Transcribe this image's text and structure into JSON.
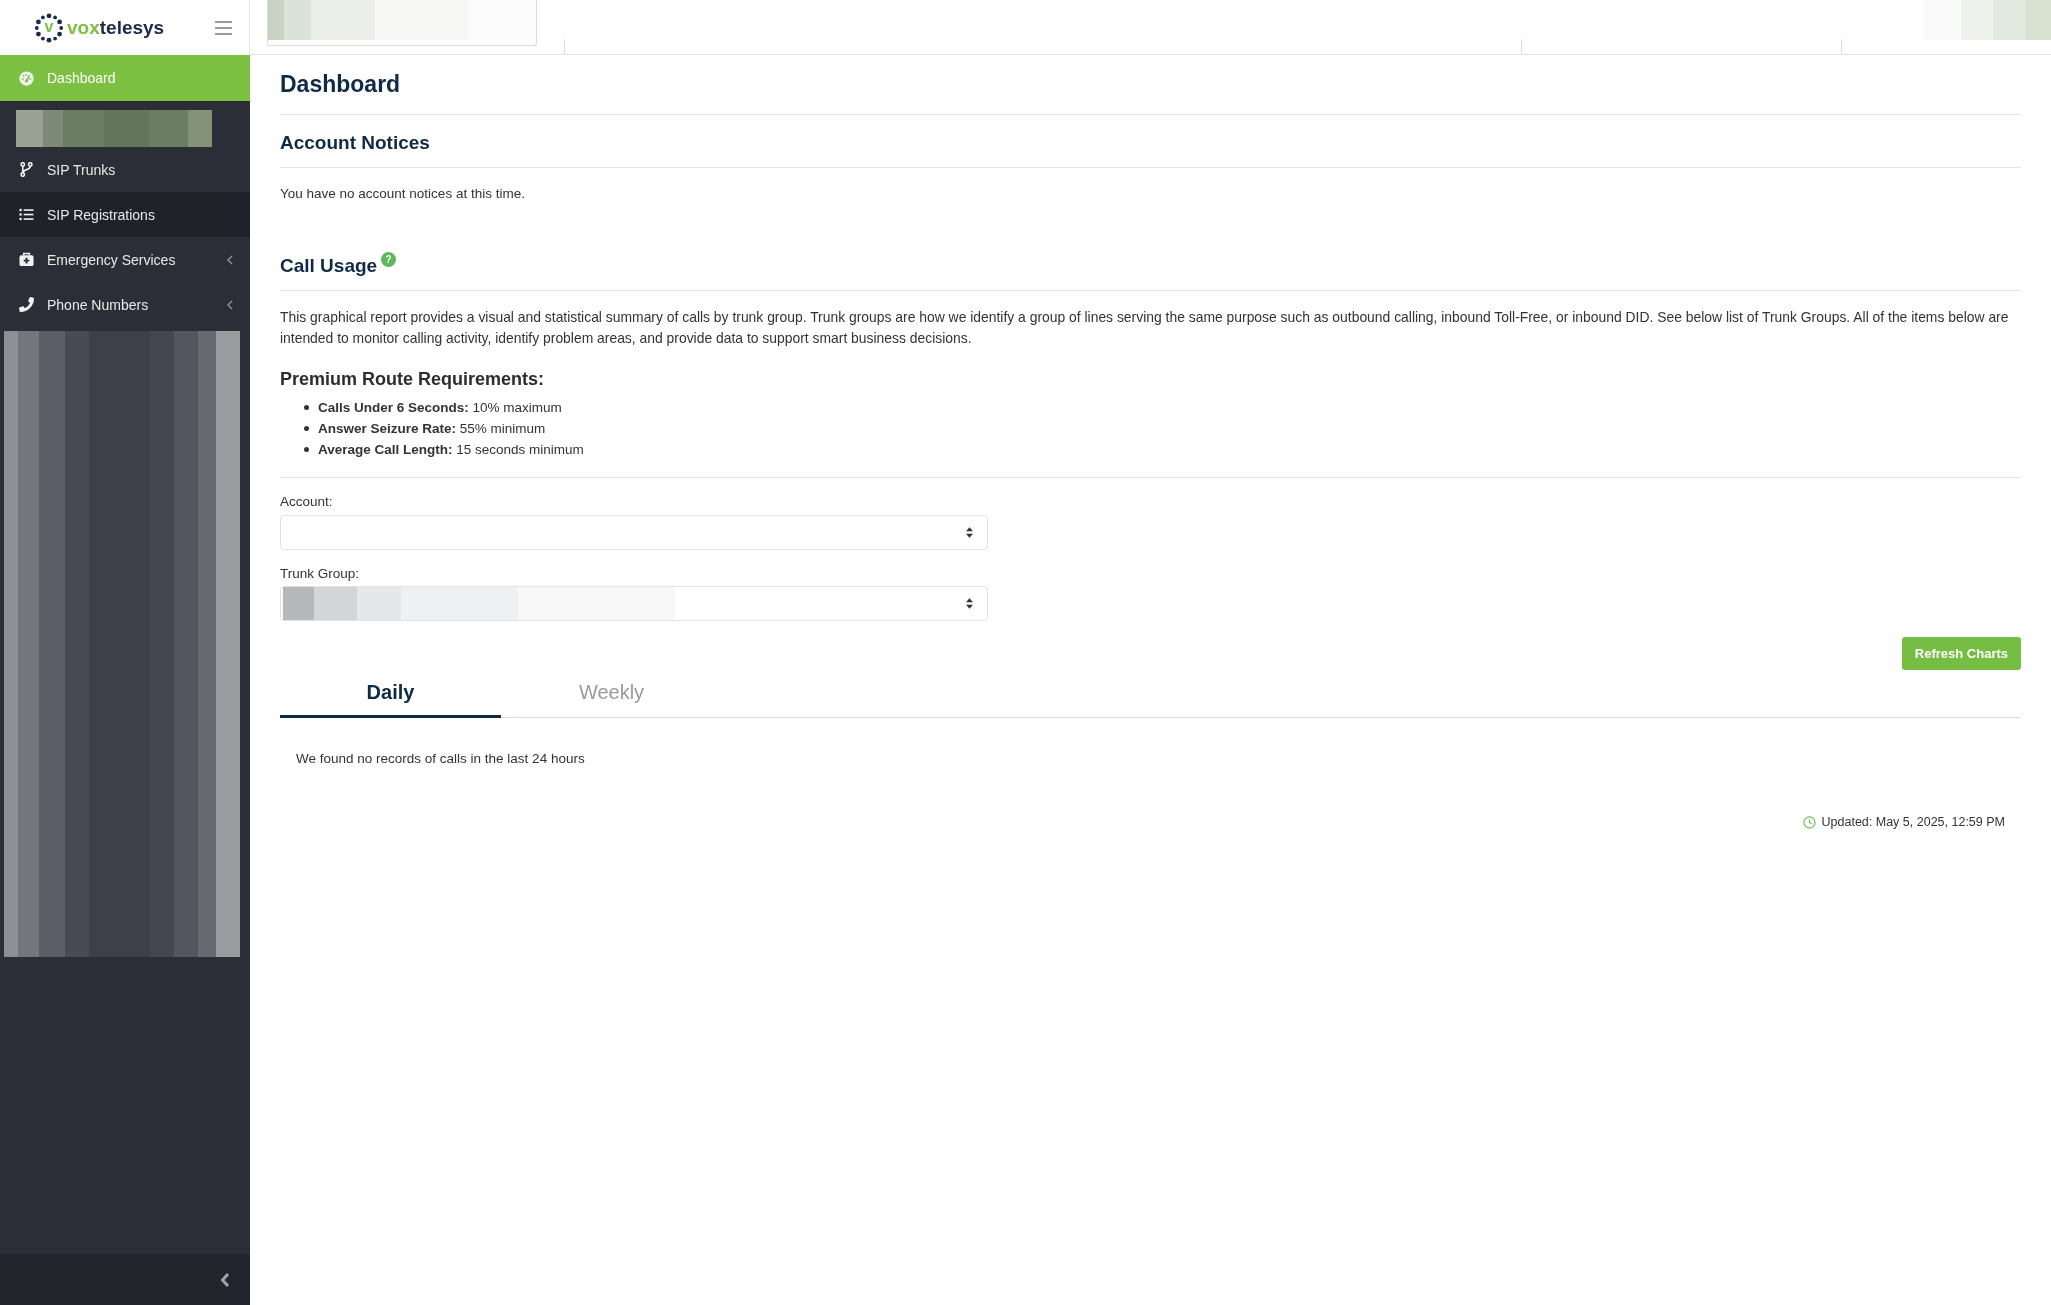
{
  "sidebar": {
    "logo": {
      "mark_letter": "v",
      "parts": [
        {
          "text": "vox",
          "kind": "accent"
        },
        {
          "text": "telesys",
          "kind": "plain"
        }
      ]
    },
    "items": [
      {
        "kind": "link",
        "label": "Dashboard",
        "selected": true,
        "hovered": false
      },
      {
        "kind": "redacted"
      },
      {
        "kind": "link",
        "label": "SIP Trunks",
        "selected": false,
        "hovered": false
      },
      {
        "kind": "link",
        "label": "SIP Registrations",
        "selected": false,
        "hovered": true
      },
      {
        "kind": "submenu",
        "label": "Emergency Services",
        "selected": false,
        "hovered": false,
        "expanded": false
      },
      {
        "kind": "submenu",
        "label": "Phone Numbers",
        "selected": false,
        "hovered": false,
        "expanded": false
      }
    ]
  },
  "page": {
    "title": "Dashboard"
  },
  "account_notices": {
    "title": "Account Notices",
    "message": "You have no account notices at this time."
  },
  "call_usage": {
    "title": "Call Usage",
    "help_icon": "?",
    "description": "This graphical report provides a visual and statistical summary of calls by trunk group. Trunk groups are how we identify a group of lines serving the same purpose such as outbound calling, inbound Toll-Free, or inbound DID. See below list of Trunk Groups. All of the items below are intended to monitor calling activity, identify problem areas, and provide data to support smart business decisions.",
    "requirements_title": "Premium Route Requirements:",
    "requirements": [
      "**Calls Under 6 Seconds:** 10% maximum",
      "**Answer Seizure Rate:** 55% minimum",
      "**Average Call Length:** 15 seconds minimum"
    ],
    "fields": [
      {
        "label": "Account:",
        "kind": "empty"
      },
      {
        "label": "Trunk Group:",
        "kind": "redacted"
      }
    ],
    "refresh_button": "Refresh Charts",
    "tabs": [
      {
        "label": "Daily",
        "selected": true
      },
      {
        "label": "Weekly",
        "selected": false
      }
    ],
    "empty_message": "We found no records of calls in the last 24 hours",
    "updated": "Updated: May 5, 2025, 12:59 PM"
  }
}
